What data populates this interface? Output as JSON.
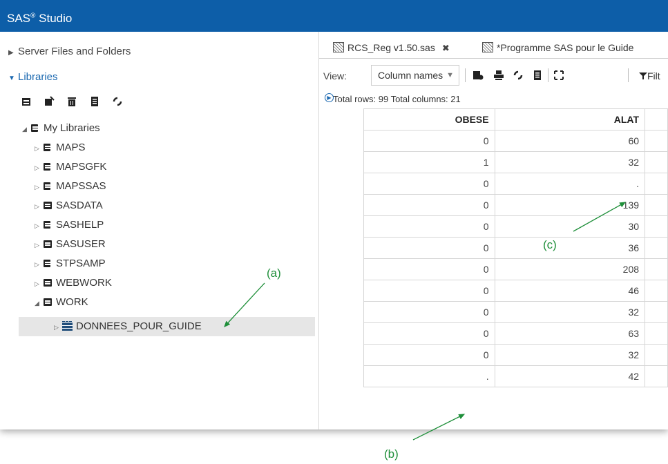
{
  "app": {
    "title_main": "SAS",
    "title_sup": "®",
    "title_rest": " Studio"
  },
  "sidebar": {
    "server_files": "Server Files and Folders",
    "libraries": "Libraries",
    "toolbar_icons": [
      "new-library-icon",
      "library-properties-icon",
      "delete-icon",
      "table-properties-icon",
      "refresh-icon"
    ],
    "my_libraries": "My Libraries",
    "libs": [
      {
        "label": "MAPS",
        "icon": "library-linked-icon"
      },
      {
        "label": "MAPSGFK",
        "icon": "library-linked-icon"
      },
      {
        "label": "MAPSSAS",
        "icon": "library-linked-icon"
      },
      {
        "label": "SASDATA",
        "icon": "library-icon"
      },
      {
        "label": "SASHELP",
        "icon": "library-linked-icon"
      },
      {
        "label": "SASUSER",
        "icon": "library-icon"
      },
      {
        "label": "STPSAMP",
        "icon": "library-linked-icon"
      },
      {
        "label": "WEBWORK",
        "icon": "library-icon"
      },
      {
        "label": "WORK",
        "icon": "library-icon"
      }
    ],
    "dataset": "DONNEES_POUR_GUIDE"
  },
  "tabs": [
    {
      "label": "RCS_Reg v1.50.sas",
      "close": "✖"
    },
    {
      "label": "*Programme SAS pour le Guide"
    }
  ],
  "viewbar": {
    "label": "View:",
    "select_value": "Column names",
    "filter_label": "Filt"
  },
  "table": {
    "info": "Total rows: 99  Total columns: 21",
    "columns": [
      "OBESE",
      "ALAT",
      ""
    ],
    "rows": [
      [
        "0",
        "60"
      ],
      [
        "1",
        "32"
      ],
      [
        "0",
        "."
      ],
      [
        "0",
        "139"
      ],
      [
        "0",
        "30"
      ],
      [
        "0",
        "36"
      ],
      [
        "0",
        "208"
      ],
      [
        "0",
        "46"
      ],
      [
        "0",
        "32"
      ],
      [
        "0",
        "63"
      ],
      [
        "0",
        "32"
      ],
      [
        ".",
        "42"
      ]
    ]
  },
  "annotations": {
    "a": "(a)",
    "b": "(b)",
    "c": "(c)"
  },
  "colors": {
    "titlebar": "#0d5ea8",
    "annotation": "#1f8f3a",
    "selection": "#e6e6e6"
  }
}
